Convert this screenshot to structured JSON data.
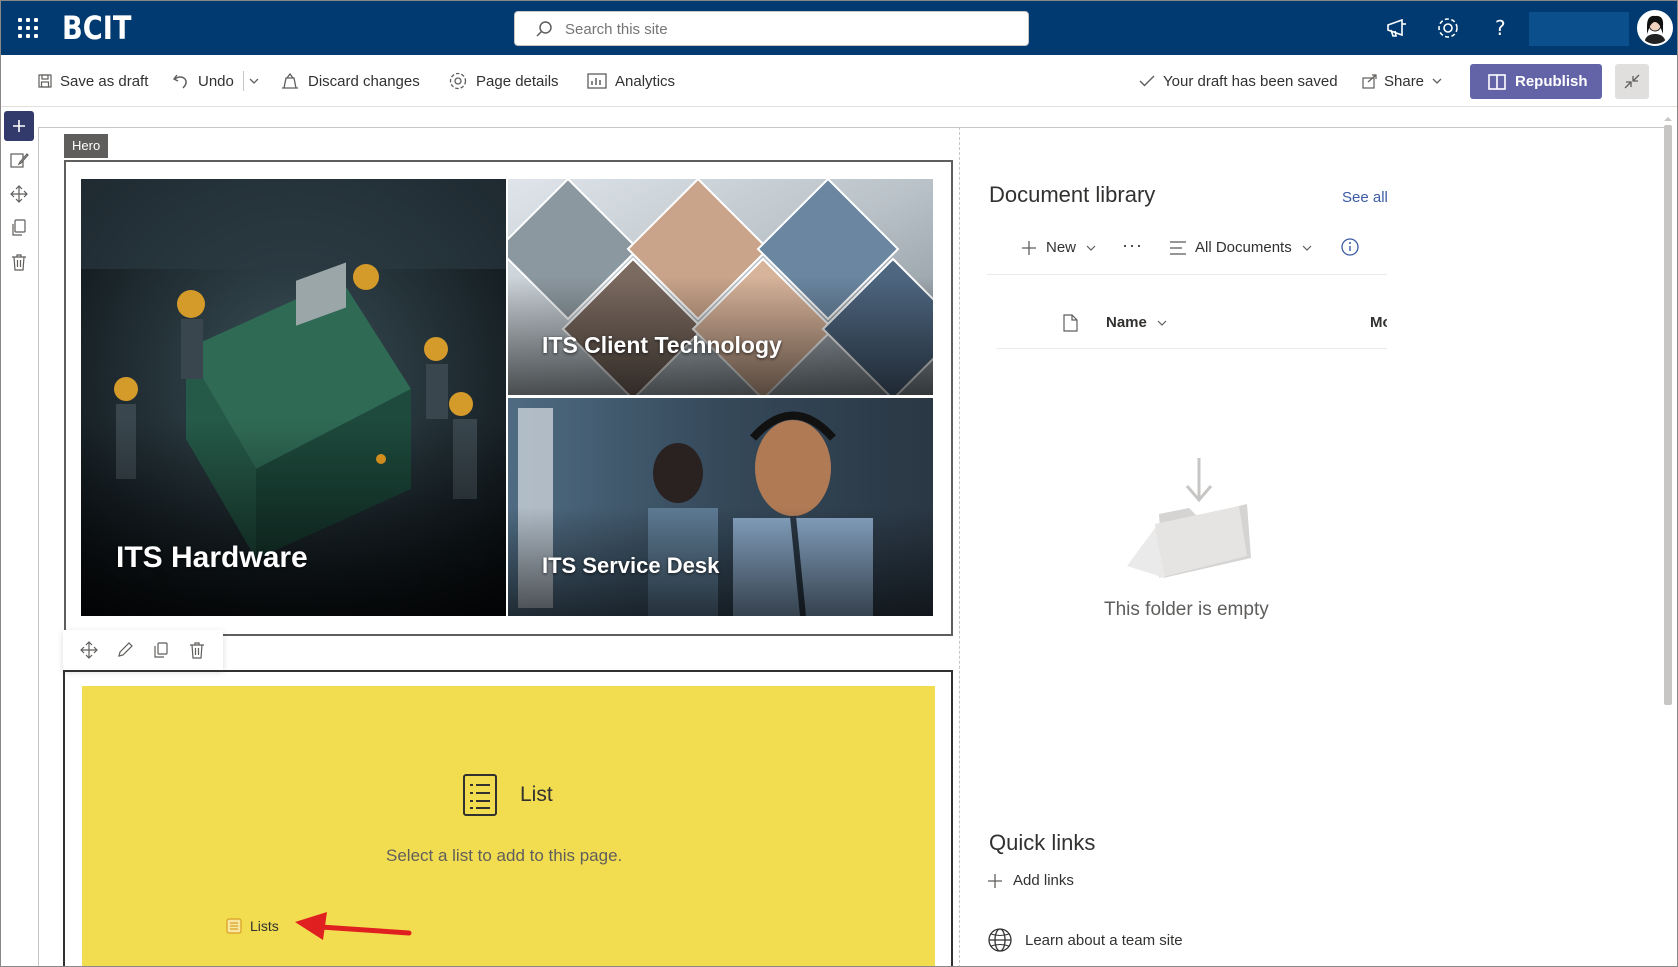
{
  "suitebar": {
    "brand": "BCIT",
    "search_placeholder": "Search this site",
    "icons": [
      "waffle-icon",
      "megaphone-icon",
      "gear-icon",
      "help-icon",
      "avatar"
    ]
  },
  "commandbar": {
    "save_as_draft": "Save as draft",
    "undo": "Undo",
    "discard_changes": "Discard changes",
    "page_details": "Page details",
    "analytics": "Analytics",
    "draft_status": "Your draft has been saved",
    "share": "Share",
    "republish": "Republish"
  },
  "hero": {
    "tag": "Hero",
    "tiles": [
      {
        "label": "ITS Hardware"
      },
      {
        "label": "ITS Client Technology"
      },
      {
        "label": "ITS Service Desk"
      }
    ]
  },
  "list_webpart": {
    "title": "List",
    "subtitle": "Select a list to add to this page.",
    "link": "Lists"
  },
  "document_library": {
    "title": "Document library",
    "see_all": "See all",
    "new": "New",
    "more": "···",
    "view": "All Documents",
    "col_name": "Name",
    "col_modified": "Mo",
    "empty": "This folder is empty"
  },
  "quick_links": {
    "title": "Quick links",
    "add": "Add links",
    "link1": "Learn about a team site"
  },
  "colors": {
    "suitebar": "#003a70",
    "republish": "#6264a7",
    "list_bg": "#f2dd50",
    "accent_link": "#3b5ba5"
  }
}
